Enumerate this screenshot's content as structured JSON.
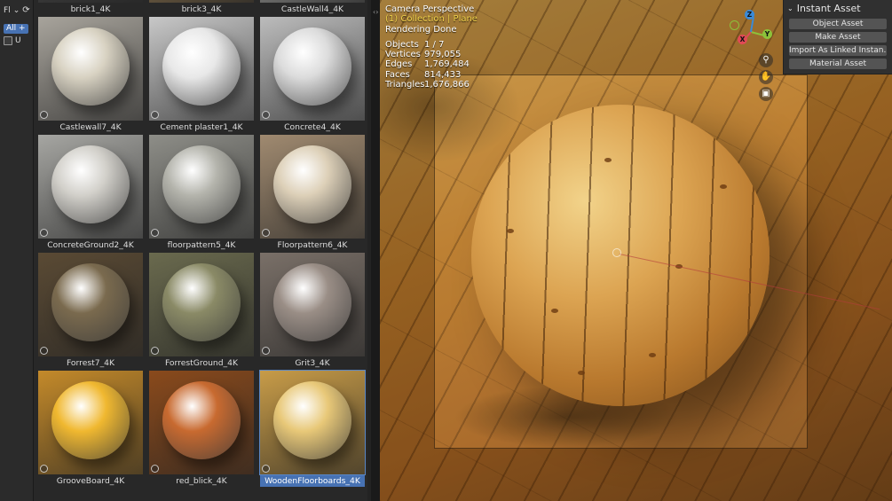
{
  "toolstrip": {
    "editor_label": "Fl",
    "filter_all": "All",
    "add_symbol": "+",
    "u_label": "U"
  },
  "assets": [
    {
      "name": "brick1_4K",
      "floor": "#3a3a3a",
      "sphere": "#8a6040"
    },
    {
      "name": "brick3_4K",
      "floor": "#6b5a40",
      "sphere": "#7a5a3a"
    },
    {
      "name": "CastleWall4_4K",
      "floor": "#7a7a78",
      "sphere": "#9a9a90"
    },
    {
      "name": "Castlewall7_4K",
      "floor": "#a8a49c",
      "sphere": "#d8d2c2"
    },
    {
      "name": "Cement plaster1_4K",
      "floor": "#c8c8c8",
      "sphere": "#e8e8e8"
    },
    {
      "name": "Concrete4_4K",
      "floor": "#bcbcbc",
      "sphere": "#dcdcdc"
    },
    {
      "name": "ConcreteGround2_4K",
      "floor": "#a6a6a2",
      "sphere": "#d2d0ca"
    },
    {
      "name": "floorpattern5_4K",
      "floor": "#8e8e88",
      "sphere": "#b4b4ac"
    },
    {
      "name": "Floorpattern6_4K",
      "floor": "#a08a70",
      "sphere": "#ddd0b8"
    },
    {
      "name": "Forrest7_4K",
      "floor": "#5a4a34",
      "sphere": "#7a6a4e"
    },
    {
      "name": "ForrestGround_4K",
      "floor": "#6a6a4e",
      "sphere": "#8a8a66"
    },
    {
      "name": "Grit3_4K",
      "floor": "#7a7068",
      "sphere": "#9a8e86"
    },
    {
      "name": "GrooveBoard_4K",
      "floor": "#c48a2a",
      "sphere": "#f0b830"
    },
    {
      "name": "red_blick_4K",
      "floor": "#8a4a1c",
      "sphere": "#c86a30"
    },
    {
      "name": "WoodenFloorboards_4K",
      "floor": "#c89c48",
      "sphere": "#e8c878"
    }
  ],
  "selected_asset": "WoodenFloorboards_4K",
  "viewport": {
    "view_name": "Camera Perspective",
    "collection_line": "(1) Collection | Plane",
    "render_status": "Rendering Done",
    "stats": [
      {
        "label": "Objects",
        "value": "1 / 7"
      },
      {
        "label": "Vertices",
        "value": "979,055"
      },
      {
        "label": "Edges",
        "value": "1,769,484"
      },
      {
        "label": "Faces",
        "value": "814,433"
      },
      {
        "label": "Triangles",
        "value": "1,676,866"
      }
    ],
    "gizmo": {
      "x": "X",
      "y": "Y",
      "z": "Z"
    },
    "nav_icons": [
      "zoom-icon",
      "hand-pan-icon",
      "camera-view-icon"
    ]
  },
  "npanel": {
    "title": "Instant Asset",
    "buttons": [
      "Object Asset",
      "Make Asset",
      "Import As Linked Instan...",
      "Material Asset"
    ]
  },
  "colors": {
    "selection": "#4772b3",
    "axis_x": "#e04a55",
    "axis_y": "#8cc23a",
    "axis_z": "#3a8ad8",
    "collection_text": "#f2d34a"
  }
}
